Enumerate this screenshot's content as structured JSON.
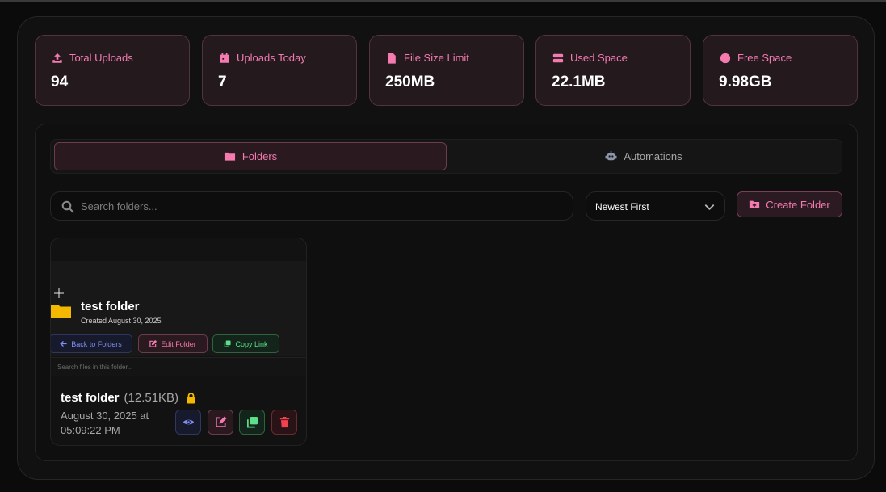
{
  "colors": {
    "accent": "#f47ab0",
    "background": "#0b0b0b",
    "folder": "#f5b800",
    "view": "#7e8ff0",
    "copy": "#5ee08a",
    "delete": "#f2424e"
  },
  "stats": [
    {
      "icon": "upload-icon",
      "label": "Total Uploads",
      "value": "94"
    },
    {
      "icon": "calendar-icon",
      "label": "Uploads Today",
      "value": "7"
    },
    {
      "icon": "file-icon",
      "label": "File Size Limit",
      "value": "250MB"
    },
    {
      "icon": "server-icon",
      "label": "Used Space",
      "value": "22.1MB"
    },
    {
      "icon": "circle-icon",
      "label": "Free Space",
      "value": "9.98GB"
    }
  ],
  "tabs": [
    {
      "icon": "folder-icon",
      "label": "Folders",
      "active": true
    },
    {
      "icon": "robot-icon",
      "label": "Automations",
      "active": false
    }
  ],
  "toolbar": {
    "search_placeholder": "Search folders...",
    "sort_selected": "Newest First",
    "create_label": "Create Folder"
  },
  "folder_card": {
    "preview": {
      "name": "test folder",
      "created": "Created August 30, 2025",
      "back_label": "Back to Folders",
      "edit_label": "Edit Folder",
      "copy_label": "Copy Link",
      "file_search_placeholder": "Search files in this folder..."
    },
    "name": "test folder",
    "size": "(12.51KB)",
    "locked": true,
    "date": "August 30, 2025 at 05:09:22 PM"
  }
}
